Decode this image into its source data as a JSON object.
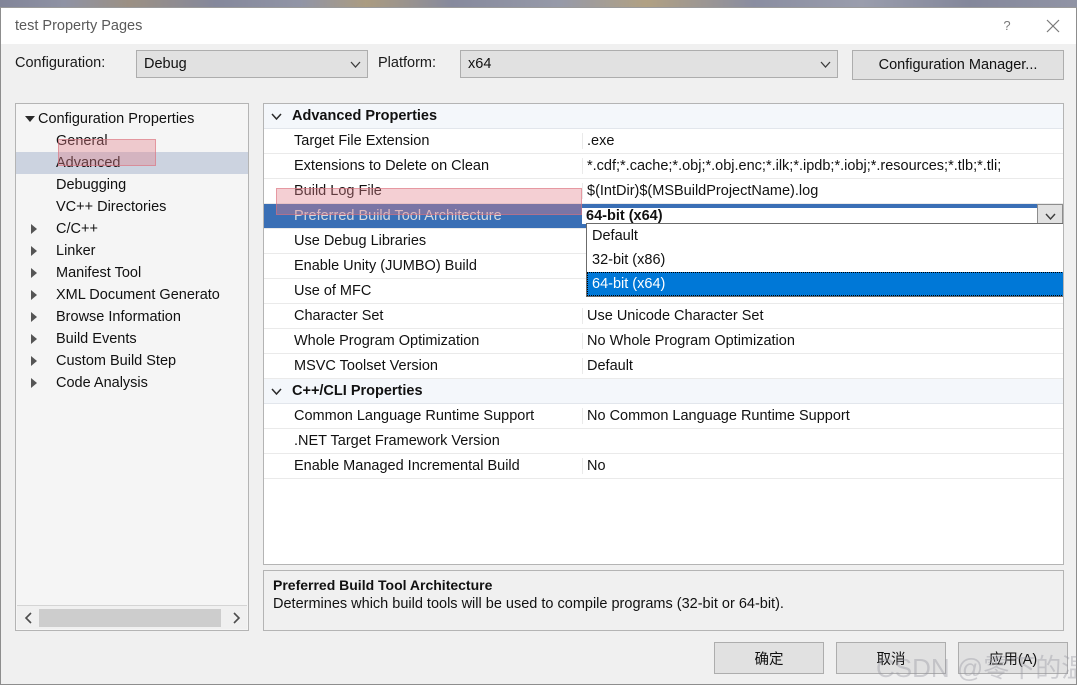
{
  "window": {
    "title": "test Property Pages",
    "help_icon": "question-mark-icon",
    "close_icon": "close-icon"
  },
  "configbar": {
    "configuration_label": "Configuration:",
    "configuration_value": "Debug",
    "platform_label": "Platform:",
    "platform_value": "x64",
    "configuration_manager_label": "Configuration Manager..."
  },
  "tree": {
    "items": [
      {
        "label": "Configuration Properties",
        "level": 0,
        "expander": "triangle-down",
        "selected": false
      },
      {
        "label": "General",
        "level": 1,
        "expander": "none",
        "selected": false
      },
      {
        "label": "Advanced",
        "level": 1,
        "expander": "none",
        "selected": true
      },
      {
        "label": "Debugging",
        "level": 1,
        "expander": "none",
        "selected": false
      },
      {
        "label": "VC++ Directories",
        "level": 1,
        "expander": "none",
        "selected": false
      },
      {
        "label": "C/C++",
        "level": 1,
        "expander": "triangle-right",
        "selected": false
      },
      {
        "label": "Linker",
        "level": 1,
        "expander": "triangle-right",
        "selected": false
      },
      {
        "label": "Manifest Tool",
        "level": 1,
        "expander": "triangle-right",
        "selected": false
      },
      {
        "label": "XML Document Generato",
        "level": 1,
        "expander": "triangle-right",
        "selected": false
      },
      {
        "label": "Browse Information",
        "level": 1,
        "expander": "triangle-right",
        "selected": false
      },
      {
        "label": "Build Events",
        "level": 1,
        "expander": "triangle-right",
        "selected": false
      },
      {
        "label": "Custom Build Step",
        "level": 1,
        "expander": "triangle-right",
        "selected": false
      },
      {
        "label": "Code Analysis",
        "level": 1,
        "expander": "triangle-right",
        "selected": false
      }
    ],
    "scroll_left_icon": "chevron-left-icon",
    "scroll_right_icon": "chevron-right-icon"
  },
  "grid": {
    "categories": [
      {
        "name": "Advanced Properties",
        "expander": "chevron-down-icon",
        "rows": [
          {
            "name": "Target File Extension",
            "value": ".exe",
            "selected": false
          },
          {
            "name": "Extensions to Delete on Clean",
            "value": "*.cdf;*.cache;*.obj;*.obj.enc;*.ilk;*.ipdb;*.iobj;*.resources;*.tlb;*.tli;",
            "selected": false
          },
          {
            "name": "Build Log File",
            "value": "$(IntDir)$(MSBuildProjectName).log",
            "selected": false
          },
          {
            "name": "Preferred Build Tool Architecture",
            "value": "64-bit (x64)",
            "selected": true
          },
          {
            "name": "Use Debug Libraries",
            "value": "",
            "selected": false
          },
          {
            "name": "Enable Unity (JUMBO) Build",
            "value": "",
            "selected": false
          },
          {
            "name": "Use of MFC",
            "value": "",
            "selected": false
          },
          {
            "name": "Character Set",
            "value": "Use Unicode Character Set",
            "selected": false
          },
          {
            "name": "Whole Program Optimization",
            "value": "No Whole Program Optimization",
            "selected": false
          },
          {
            "name": "MSVC Toolset Version",
            "value": "Default",
            "selected": false
          }
        ]
      },
      {
        "name": "C++/CLI Properties",
        "expander": "chevron-down-icon",
        "rows": [
          {
            "name": "Common Language Runtime Support",
            "value": "No Common Language Runtime Support",
            "selected": false
          },
          {
            "name": ".NET Target Framework Version",
            "value": "",
            "selected": false
          },
          {
            "name": "Enable Managed Incremental Build",
            "value": "No",
            "selected": false
          }
        ]
      }
    ],
    "editor_arrow_icon": "chevron-down-icon"
  },
  "dropdown": {
    "options": [
      {
        "label": "Default",
        "highlighted": false
      },
      {
        "label": "32-bit (x86)",
        "highlighted": false
      },
      {
        "label": "64-bit (x64)",
        "highlighted": true
      }
    ]
  },
  "description": {
    "title": "Preferred Build Tool Architecture",
    "body": "Determines which build tools will be used to compile programs (32-bit or 64-bit)."
  },
  "footer": {
    "ok_label": "确定",
    "cancel_label": "取消",
    "apply_label": "应用(A)"
  },
  "watermark": {
    "text": "CSDN @零下的温度"
  },
  "colors": {
    "selection_blue": "#3a6fb5",
    "dropdown_highlight": "#0078d7",
    "annotation_pink": "#e2828c",
    "tree_selection": "#ccd3e0"
  }
}
